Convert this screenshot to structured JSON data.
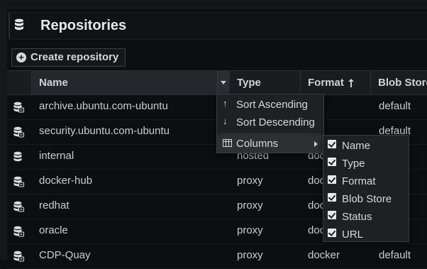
{
  "header": {
    "title": "Repositories",
    "icon": "database-icon"
  },
  "toolbar": {
    "create_label": "Create repository"
  },
  "columns": {
    "name": "Name",
    "type": "Type",
    "format": "Format",
    "blob_store": "Blob Store"
  },
  "rows": [
    {
      "name": "archive.ubuntu.com-ubuntu",
      "type": "",
      "format": "",
      "blob_store": "default",
      "icon": "proxy-repo-icon"
    },
    {
      "name": "security.ubuntu.com-ubuntu",
      "type": "",
      "format": "",
      "blob_store": "default",
      "icon": "proxy-repo-icon"
    },
    {
      "name": "internal",
      "type": "hosted",
      "format": "doc",
      "blob_store": "",
      "icon": "hosted-repo-icon"
    },
    {
      "name": "docker-hub",
      "type": "proxy",
      "format": "doc",
      "blob_store": "",
      "icon": "proxy-repo-icon"
    },
    {
      "name": "redhat",
      "type": "proxy",
      "format": "doc",
      "blob_store": "",
      "icon": "proxy-repo-icon"
    },
    {
      "name": "oracle",
      "type": "proxy",
      "format": "doc",
      "blob_store": "",
      "icon": "proxy-repo-icon"
    },
    {
      "name": "CDP-Quay",
      "type": "proxy",
      "format": "docker",
      "blob_store": "default",
      "icon": "proxy-repo-icon"
    }
  ],
  "column_menu": {
    "sort_asc": "Sort Ascending",
    "sort_desc": "Sort Descending",
    "columns": "Columns"
  },
  "columns_submenu": {
    "items": [
      {
        "label": "Name",
        "checked": true
      },
      {
        "label": "Type",
        "checked": true
      },
      {
        "label": "Format",
        "checked": true
      },
      {
        "label": "Blob Store",
        "checked": true
      },
      {
        "label": "Status",
        "checked": true
      },
      {
        "label": "URL",
        "checked": true
      }
    ]
  }
}
